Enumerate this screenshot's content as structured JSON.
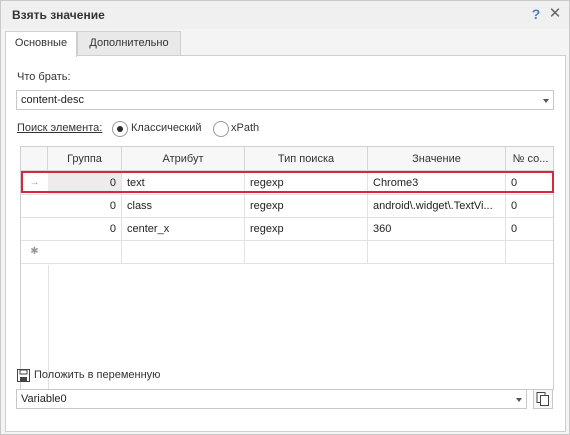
{
  "window": {
    "title": "Взять значение",
    "help_glyph": "?",
    "close_glyph": "✕"
  },
  "tabs": [
    {
      "label": "Основные",
      "active": true
    },
    {
      "label": "Дополнительно",
      "active": false
    }
  ],
  "what_to_take": {
    "label": "Что брать:",
    "value": "content-desc"
  },
  "search": {
    "label": "Поиск элемента:",
    "options": [
      {
        "label": "Классический",
        "selected": true
      },
      {
        "label": "xPath",
        "selected": false
      }
    ]
  },
  "grid": {
    "columns": [
      "Группа",
      "Атрибут",
      "Тип поиска",
      "Значение",
      "№ со..."
    ],
    "rows": [
      {
        "group": "0",
        "attribute": "text",
        "search_type": "regexp",
        "value": "Chrome3",
        "number": "0",
        "marker": "→",
        "selected": true
      },
      {
        "group": "0",
        "attribute": "class",
        "search_type": "regexp",
        "value": "android\\.widget\\.TextVi...",
        "number": "0",
        "marker": "",
        "selected": false
      },
      {
        "group": "0",
        "attribute": "center_x",
        "search_type": "regexp",
        "value": "360",
        "number": "0",
        "marker": "",
        "selected": false
      }
    ],
    "new_row_marker": "✱"
  },
  "save_to_variable": {
    "label": "Положить в переменную",
    "value": "Variable0",
    "icon": "save-icon"
  },
  "colors": {
    "selection_outline": "#d6283c",
    "accent": "#4a7fc0"
  }
}
